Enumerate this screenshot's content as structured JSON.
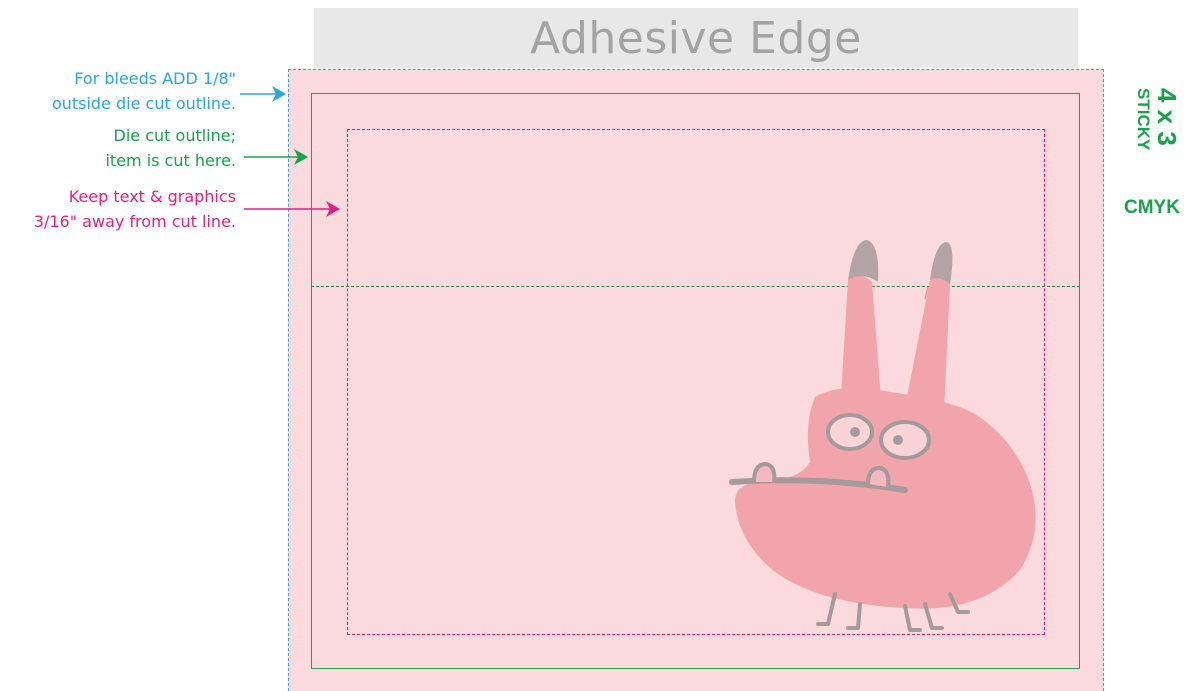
{
  "template": {
    "adhesive_label": "Adhesive Edge",
    "size_label": "4 x 3",
    "type_label": "STICKY",
    "color_mode": "CMYK"
  },
  "notes": {
    "bleed": [
      "For bleeds ADD 1/8\"",
      "outside die cut outline."
    ],
    "die_cut": [
      "Die cut outline;",
      "item is cut here."
    ],
    "safe_zone": [
      "Keep text & graphics",
      "3/16\" away from cut line."
    ]
  },
  "colors": {
    "bleed_line": "#3aa7d9",
    "die_cut_line": "#1aa74a",
    "safe_zone_line": "#e0217f",
    "sheet_fill": "#fadadd",
    "adhesive_fill": "#e8e8e8",
    "monster_fill": "#f2a4ac",
    "monster_line": "#a49a9a"
  },
  "illustration": {
    "name": "pink furry monster"
  }
}
